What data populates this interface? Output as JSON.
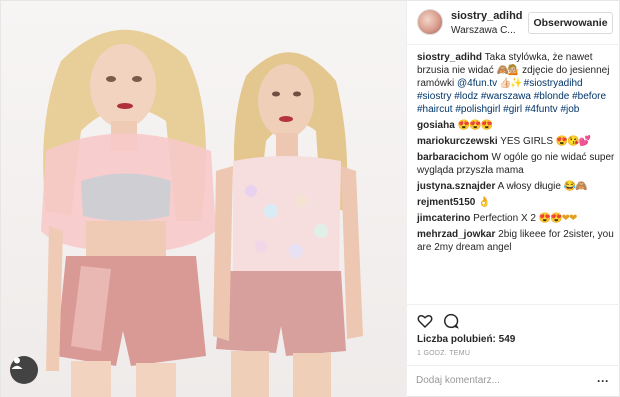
{
  "post": {
    "username": "siostry_adihd",
    "location": "Warszawa C...",
    "follow_label": "Obserwowanie",
    "caption": {
      "text1": "Taka stylówka, że nawet brzusia nie widać ",
      "emoji1": "🙈💁🏼",
      "text2": " zdjęcie do jesiennej ramówki ",
      "mention": "@4fun.tv",
      "emoji2": " 👍🏻✨ ",
      "hashtags": [
        "#siostryadihd",
        "#siostry",
        "#lodz",
        "#warszawa",
        "#blonde",
        "#before",
        "#haircut",
        "#polishgirl",
        "#girl",
        "#4funtv",
        "#job"
      ]
    },
    "comments": [
      {
        "user": "gosiaha",
        "text": "",
        "emoji": "😍😍😍"
      },
      {
        "user": "mariokurczewski",
        "text": "YES GIRLS ",
        "emoji": "😍😘💕"
      },
      {
        "user": "barbaracichom",
        "text": "W ogóle go nie widać super wygląda przyszła mama",
        "emoji": ""
      },
      {
        "user": "justyna.sznajder",
        "text": "A włosy długie ",
        "emoji": "😂🙈"
      },
      {
        "user": "rejment5150",
        "text": "",
        "emoji": "👌"
      },
      {
        "user": "jimcaterino",
        "text": "Perfection X 2 ",
        "emoji": "😍😍❤❤"
      },
      {
        "user": "mehrzad_jowkar",
        "text": "2big likeee for 2sister, you are 2my dream angel",
        "emoji": ""
      }
    ],
    "likes_label": "Liczba polubień: 549",
    "time_label": "1 GODZ. TEMU",
    "add_comment_placeholder": "Dodaj komentarz...",
    "more_label": "···"
  },
  "icons": {
    "heart": "heart-icon",
    "comment": "comment-bubble-icon",
    "user_tag": "user-tag-icon",
    "more": "more-options-icon"
  },
  "colors": {
    "link": "#003569",
    "text": "#262626",
    "muted": "#999999",
    "border": "#efefef"
  }
}
